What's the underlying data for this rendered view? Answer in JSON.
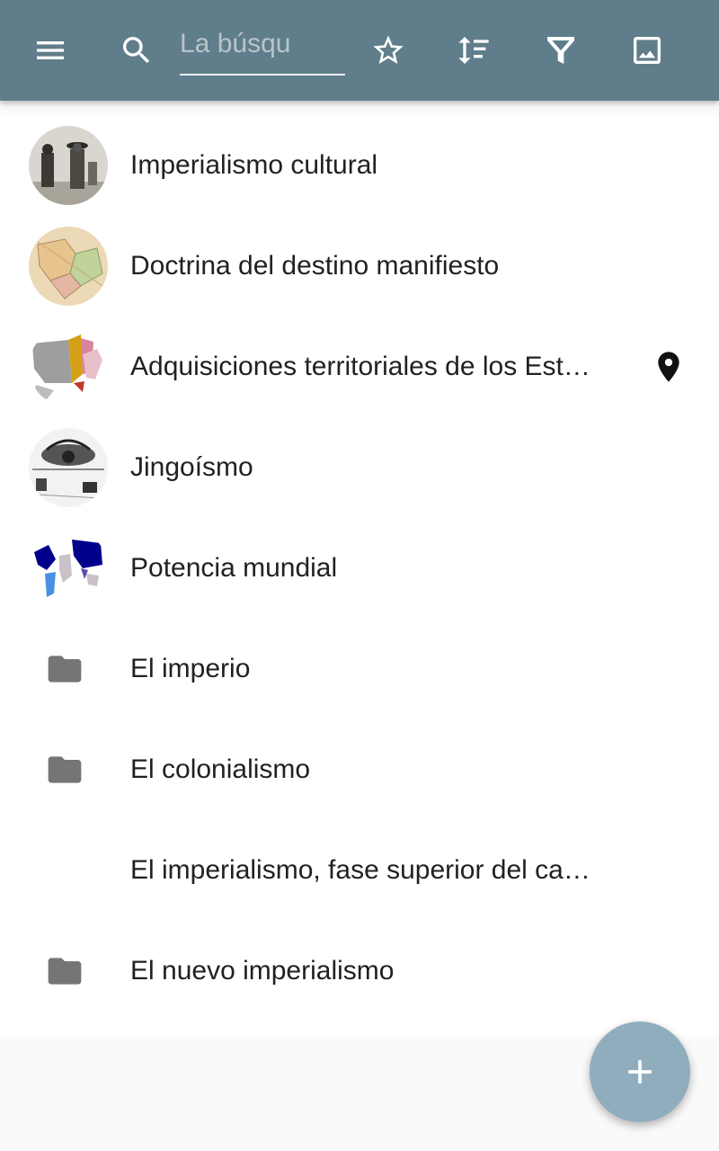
{
  "toolbar": {
    "menu_icon": "menu-icon",
    "search_icon": "search-icon",
    "search_placeholder": "La búsqu",
    "actions": [
      {
        "icon": "star-outline-icon"
      },
      {
        "icon": "sort-icon"
      },
      {
        "icon": "filter-icon"
      },
      {
        "icon": "image-icon"
      }
    ],
    "color": "#607d8b"
  },
  "list": {
    "items": [
      {
        "label": "Imperialismo cultural",
        "kind": "article",
        "thumb": "engraving-thumbnail"
      },
      {
        "label": "Doctrina del destino manifiesto",
        "kind": "article",
        "thumb": "old-map-thumbnail"
      },
      {
        "label": "Adquisiciones territoriales de los Estados Unidos",
        "kind": "article",
        "thumb": "us-map-thumbnail",
        "has_location": true
      },
      {
        "label": "Jingoísmo",
        "kind": "article",
        "thumb": "cartoon-thumbnail"
      },
      {
        "label": "Potencia mundial",
        "kind": "article",
        "thumb": "world-map-thumbnail"
      },
      {
        "label": "El imperio",
        "kind": "folder"
      },
      {
        "label": "El colonialismo",
        "kind": "folder"
      },
      {
        "label": "El imperialismo, fase superior del capitalismo",
        "kind": "article-no-image"
      },
      {
        "label": "El nuevo imperialismo",
        "kind": "folder"
      }
    ]
  },
  "fab": {
    "icon": "add-icon",
    "color": "#90adbd"
  }
}
